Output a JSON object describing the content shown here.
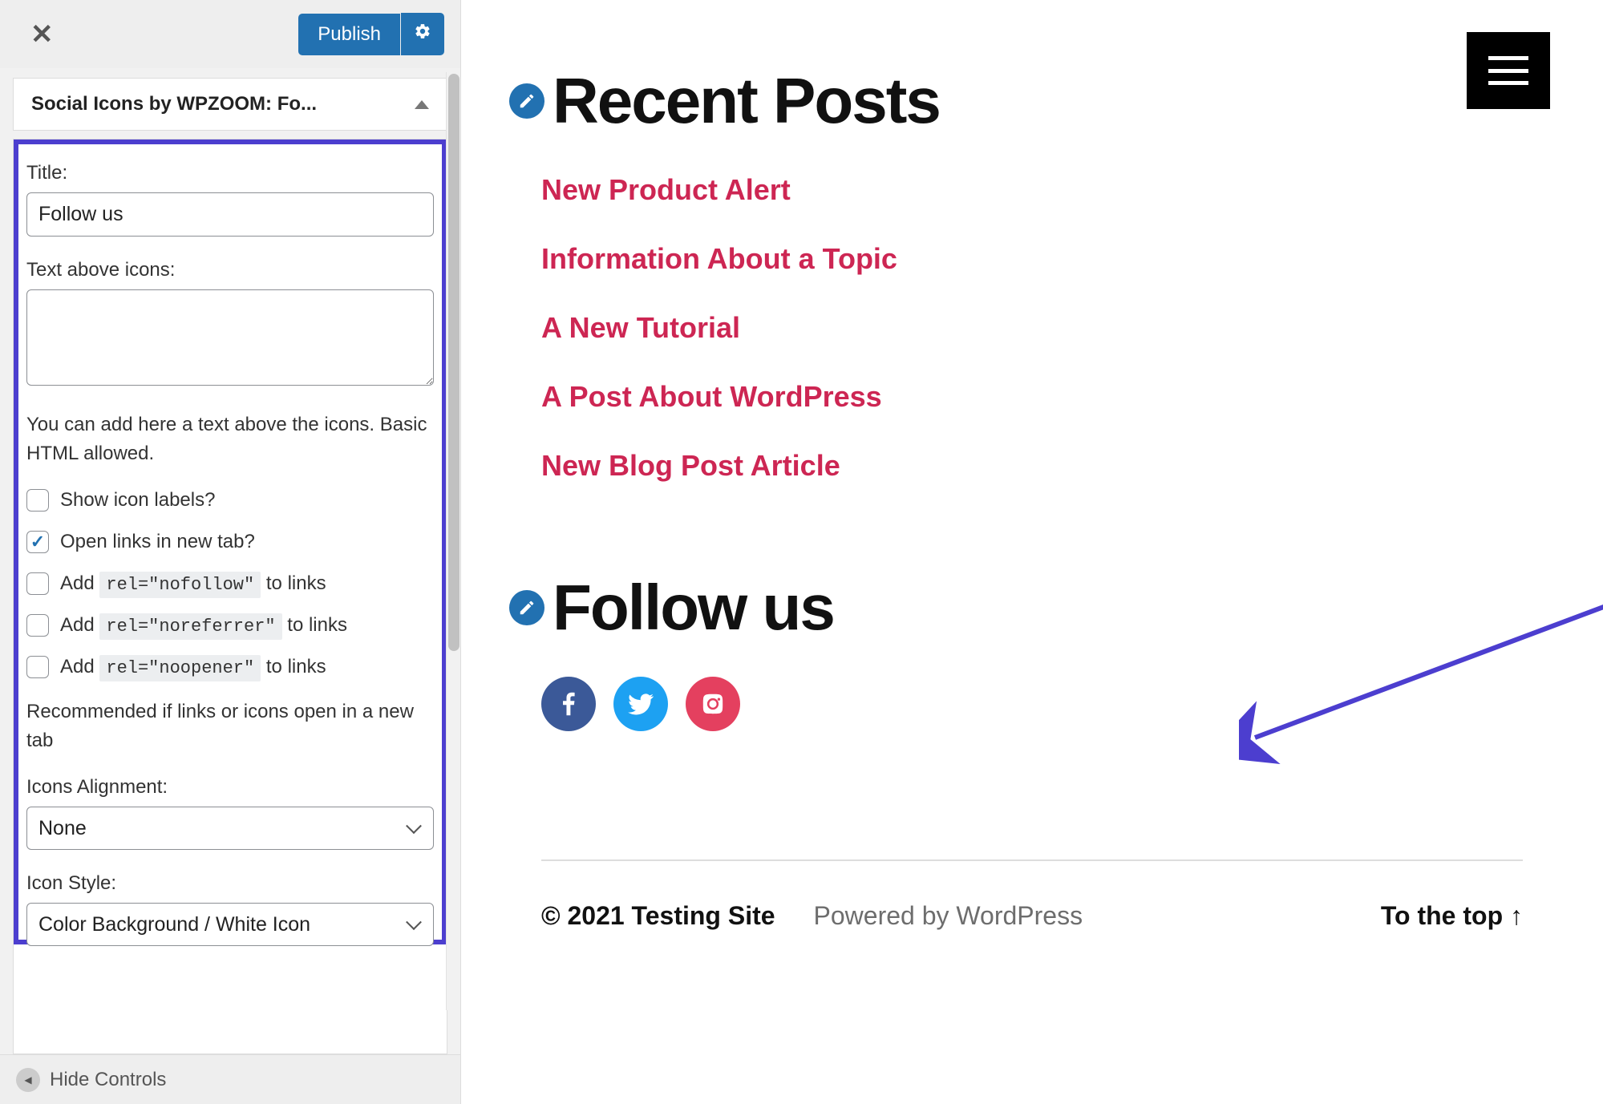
{
  "sidebar": {
    "publish_label": "Publish",
    "accordion_title": "Social Icons by WPZOOM: Fo...",
    "title_label": "Title:",
    "title_value": "Follow us",
    "text_above_label": "Text above icons:",
    "text_above_value": "",
    "help_text": "You can add here a text above the icons. Basic HTML allowed.",
    "cb_show_labels": "Show icon labels?",
    "cb_new_tab": "Open links in new tab?",
    "cb_add_prefix": "Add ",
    "cb_to_links": " to links",
    "rel_nofollow": "rel=\"nofollow\"",
    "rel_noreferrer": "rel=\"noreferrer\"",
    "rel_noopener": "rel=\"noopener\"",
    "recommended_text": "Recommended if links or icons open in a new tab",
    "alignment_label": "Icons Alignment:",
    "alignment_value": "None",
    "style_label": "Icon Style:",
    "style_value": "Color Background / White Icon",
    "hide_controls": "Hide Controls"
  },
  "preview": {
    "recent_title": "Recent Posts",
    "posts": [
      "New Product Alert",
      "Information About a Topic",
      "A New Tutorial",
      "A Post About WordPress",
      "New Blog Post Article"
    ],
    "follow_title": "Follow us",
    "copyright": "© 2021 Testing Site",
    "powered": "Powered by WordPress",
    "to_top": "To the top ↑"
  }
}
